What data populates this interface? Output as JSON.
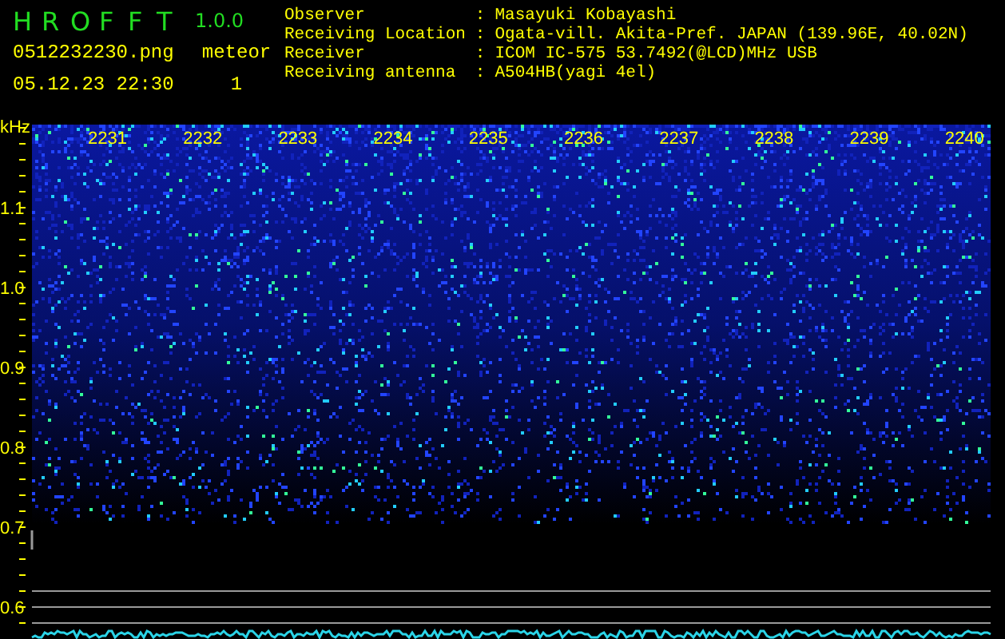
{
  "app": {
    "title_letters": [
      "H",
      "R",
      "O",
      "F",
      "F",
      "T"
    ],
    "version": "1.0.0"
  },
  "file": {
    "name": "0512232230.png",
    "timestamp": "05.12.23 22:30"
  },
  "meteor": {
    "label": "meteor",
    "count": "1"
  },
  "station": [
    {
      "label": "Observer",
      "separator": ":",
      "value": "Masayuki Kobayashi"
    },
    {
      "label": "Receiving Location",
      "separator": ":",
      "value": "Ogata-vill. Akita-Pref. JAPAN (139.96E, 40.02N)"
    },
    {
      "label": "Receiver",
      "separator": ":",
      "value": "ICOM IC-575 53.7492(@LCD)MHz USB"
    },
    {
      "label": "Receiving antenna",
      "separator": ":",
      "value": "A504HB(yagi 4el)"
    }
  ],
  "spectrogram": {
    "unit": "kHz",
    "y_labels": [
      "1.1",
      "1.0",
      "0.9",
      "0.8",
      "0.7",
      "0.6"
    ],
    "time_labels": [
      "2231",
      "2232",
      "2233",
      "2234",
      "2235",
      "2236",
      "2237",
      "2238",
      "2239",
      "2240"
    ]
  }
}
